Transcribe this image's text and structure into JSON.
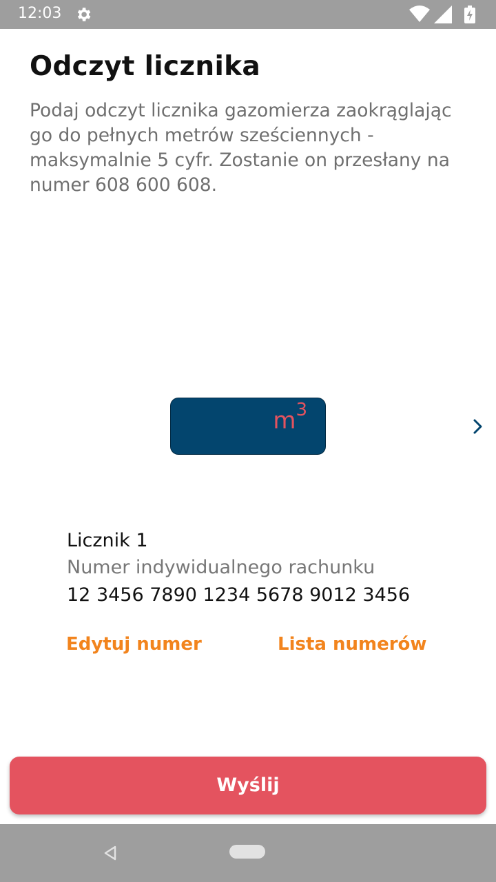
{
  "status_bar": {
    "time": "12:03",
    "icons": [
      "gear-icon",
      "wifi-icon",
      "signal-icon",
      "battery-icon"
    ]
  },
  "main": {
    "title": "Odczyt licznika",
    "description": "Podaj odczyt licznika gazomierza zaokrąglając go do pełnych metrów sześciennych - maksymalnie 5 cyfr. Zostanie on przesłany na numer 608 600 608."
  },
  "meter_input": {
    "value": "",
    "unit": "m",
    "unit_exponent": "3"
  },
  "meter": {
    "name": "Licznik 1",
    "account_label": "Numer indywidualnego rachunku",
    "account_number": "12 3456 7890 1234 5678 9012 3456"
  },
  "links": {
    "edit": "Edytuj numer",
    "list": "Lista numerów"
  },
  "submit_label": "Wyślij",
  "colors": {
    "accent": "#e4535f",
    "link": "#f2841d",
    "input_bg": "#03456e"
  }
}
